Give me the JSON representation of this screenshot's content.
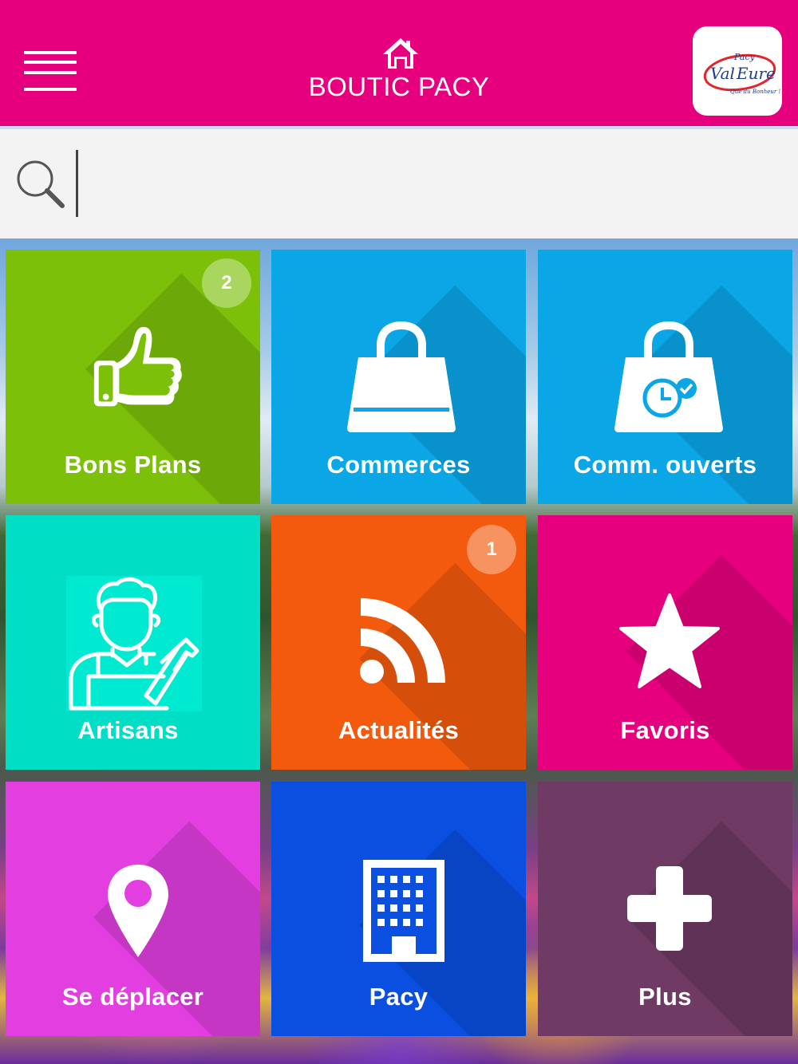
{
  "header": {
    "title": "BOUTIC PACY",
    "menu_icon": "hamburger-menu-icon",
    "home_icon": "home-icon",
    "logo": {
      "line1": "Pacy",
      "line2": "Val d'Eure",
      "tagline": "Que du Bonheur !"
    },
    "color": "#e6007e"
  },
  "search": {
    "placeholder": "",
    "value": "",
    "icon": "search-icon"
  },
  "tiles": [
    {
      "label": "Bons Plans",
      "icon": "thumbs-up-icon",
      "badge": "2",
      "color": "#7cc00a"
    },
    {
      "label": "Commerces",
      "icon": "shopping-bag-icon",
      "color": "#0aa6e6"
    },
    {
      "label": "Comm. ouverts",
      "icon": "shopping-bag-clock-icon",
      "color": "#0aa6e6"
    },
    {
      "label": "Artisans",
      "icon": "craftsman-icon",
      "color": "#00dfc6"
    },
    {
      "label": "Actualités",
      "icon": "rss-icon",
      "badge": "1",
      "color": "#f35a0d"
    },
    {
      "label": "Favoris",
      "icon": "star-icon",
      "color": "#e6007e"
    },
    {
      "label": "Se déplacer",
      "icon": "map-pin-icon",
      "color": "#e23ee0"
    },
    {
      "label": "Pacy",
      "icon": "building-icon",
      "color": "#0a4fe0"
    },
    {
      "label": "Plus",
      "icon": "plus-icon",
      "color": "#6f3a64"
    }
  ]
}
